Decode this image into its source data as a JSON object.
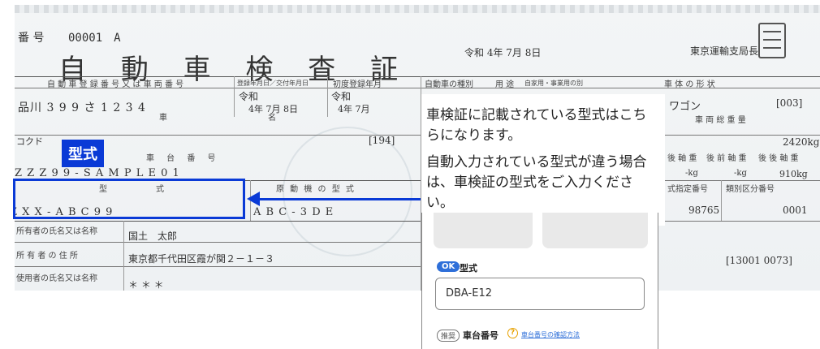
{
  "certificate": {
    "number_label": "番 号",
    "number_value": "00001　A",
    "title_chars": [
      "自",
      "動",
      "車",
      "検",
      "査",
      "証"
    ],
    "date": "令和 4年 7月 8日",
    "issuer": "東京運輸支局長",
    "headers": {
      "registration": "自 動 車 登 録 番 号 又 は 車 両 番 号",
      "issue_date": "登録年月日／交付年月日",
      "first_reg": "初度登録年月",
      "vehicle_kind": "自動車の種別",
      "usage": "用 途",
      "private_business": "自家用・事業用の別",
      "body_shape": "車 体 の 形 状"
    },
    "reg_plate": "品川 3 9 9 さ 1 2 3 4",
    "reiwa_1": "令和",
    "reiwa_1_date": "4年 7月 8日",
    "reiwa_2": "令和",
    "reiwa_2_date": "4年 7月",
    "car_label": "車",
    "name_label": "名",
    "body_value": "ワゴン",
    "body_code": "[003]",
    "weight_header": "車 両 総 重 量",
    "weight_value": "2420kg",
    "maker_partial": "コクド",
    "maker_code": "[194]",
    "chassis_header": "車 台 番 号",
    "axle_header1": "後 軸 重",
    "axle_header2": "後 前 軸 重",
    "axle_header3": "後 後 軸 重",
    "chassis_value": "Z Z Z 9 9 - S A M P L E 0 1",
    "axle_vals": [
      "-kg",
      "-kg",
      "910kg"
    ],
    "model_header": "型　　　　　　式",
    "engine_header": "原 動 機 の 型 式",
    "model_value": "Z X X - A B C 9 9",
    "engine_value": "A B C - 3 D E",
    "type_designation_header": "式指定番号",
    "class_header": "類別区分番号",
    "type_designation_value": "98765",
    "class_value": "0001",
    "owner_name_label": "所有者の氏名又は名称",
    "owner_name_value": "国土　太郎",
    "owner_addr_label": "所 有 者 の 住 所",
    "owner_addr_value": "東京都千代田区霞が関２－１－３",
    "owner_addr_code": "[13001 0073]",
    "user_name_label": "使用者の氏名又は名称",
    "user_name_value": "＊ ＊ ＊"
  },
  "annotation": {
    "tag": "型式",
    "callout_line1": "車検証に記載されている型式はこちらになります。",
    "callout_line2": "自動入力されている型式が違う場合は、車検証の型式をご入力ください。"
  },
  "form": {
    "ok_badge": "OK",
    "model_label": "型式",
    "model_input_value": "DBA-E12",
    "recommended_badge": "推奨",
    "chassis_label": "車台番号",
    "help_icon": "?",
    "chassis_help_link": "車台番号の確認方法"
  },
  "colors": {
    "accent": "#0a3ad6",
    "ok": "#2e6fd9",
    "help": "#e7a100"
  }
}
